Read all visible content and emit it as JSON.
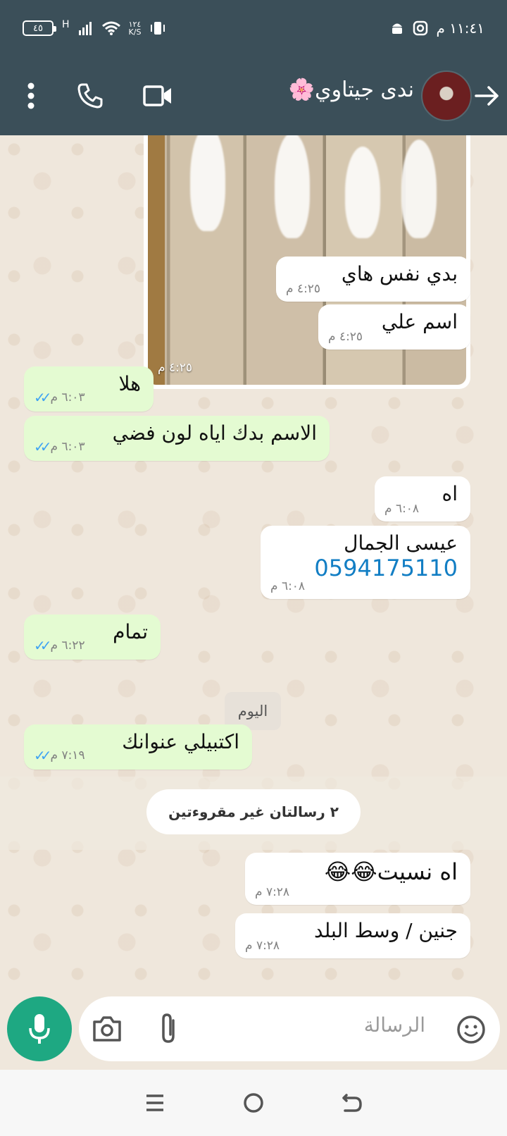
{
  "status_bar": {
    "time": "١١:٤١ م",
    "battery": "٤٥",
    "network": "H",
    "speed_value": "١٢٤",
    "speed_unit": "K/S"
  },
  "header": {
    "contact_name": "ندى جيتاوي🌸",
    "icons": [
      "back-arrow-icon",
      "avatar",
      "video-call-icon",
      "phone-call-icon",
      "more-vert-icon"
    ]
  },
  "messages": [
    {
      "dir": "in",
      "type": "image",
      "time": "٤:٢٥ م"
    },
    {
      "dir": "in",
      "text": "بدي نفس هاي",
      "time": "٤:٢٥ م"
    },
    {
      "dir": "in",
      "text": "اسم علي",
      "time": "٤:٢٥ م"
    },
    {
      "dir": "out",
      "text": "هلا",
      "time": "٦:٠٣ م",
      "status": "read"
    },
    {
      "dir": "out",
      "text": "الاسم بدك اياه لون فضي",
      "time": "٦:٠٣ م",
      "status": "read"
    },
    {
      "dir": "in",
      "text": "اه",
      "time": "٦:٠٨ م"
    },
    {
      "dir": "in",
      "text": "عيسى الجمال",
      "phone": "0594175110",
      "time": "٦:٠٨ م"
    },
    {
      "dir": "out",
      "text": "تمام",
      "time": "٦:٢٢ م",
      "status": "read"
    },
    {
      "dir": "out",
      "text": "اكتبيلي عنوانك",
      "time": "٧:١٩ م",
      "status": "read"
    },
    {
      "dir": "in",
      "text": "اه نسيت😂😂",
      "time": "٧:٢٨ م"
    },
    {
      "dir": "in",
      "text": "جنين / وسط البلد",
      "time": "٧:٢٨ م"
    }
  ],
  "date_separator": "اليوم",
  "unread_banner": "٢ رسالتان غير مقروءتين",
  "compose": {
    "placeholder": "الرسالة"
  },
  "colors": {
    "header_bg": "#3b4f59",
    "outgoing_bubble": "#e4fbd2",
    "incoming_bubble": "#ffffff",
    "read_ticks": "#40a3f2",
    "mic_button": "#1ea882",
    "link": "#127ec4"
  }
}
